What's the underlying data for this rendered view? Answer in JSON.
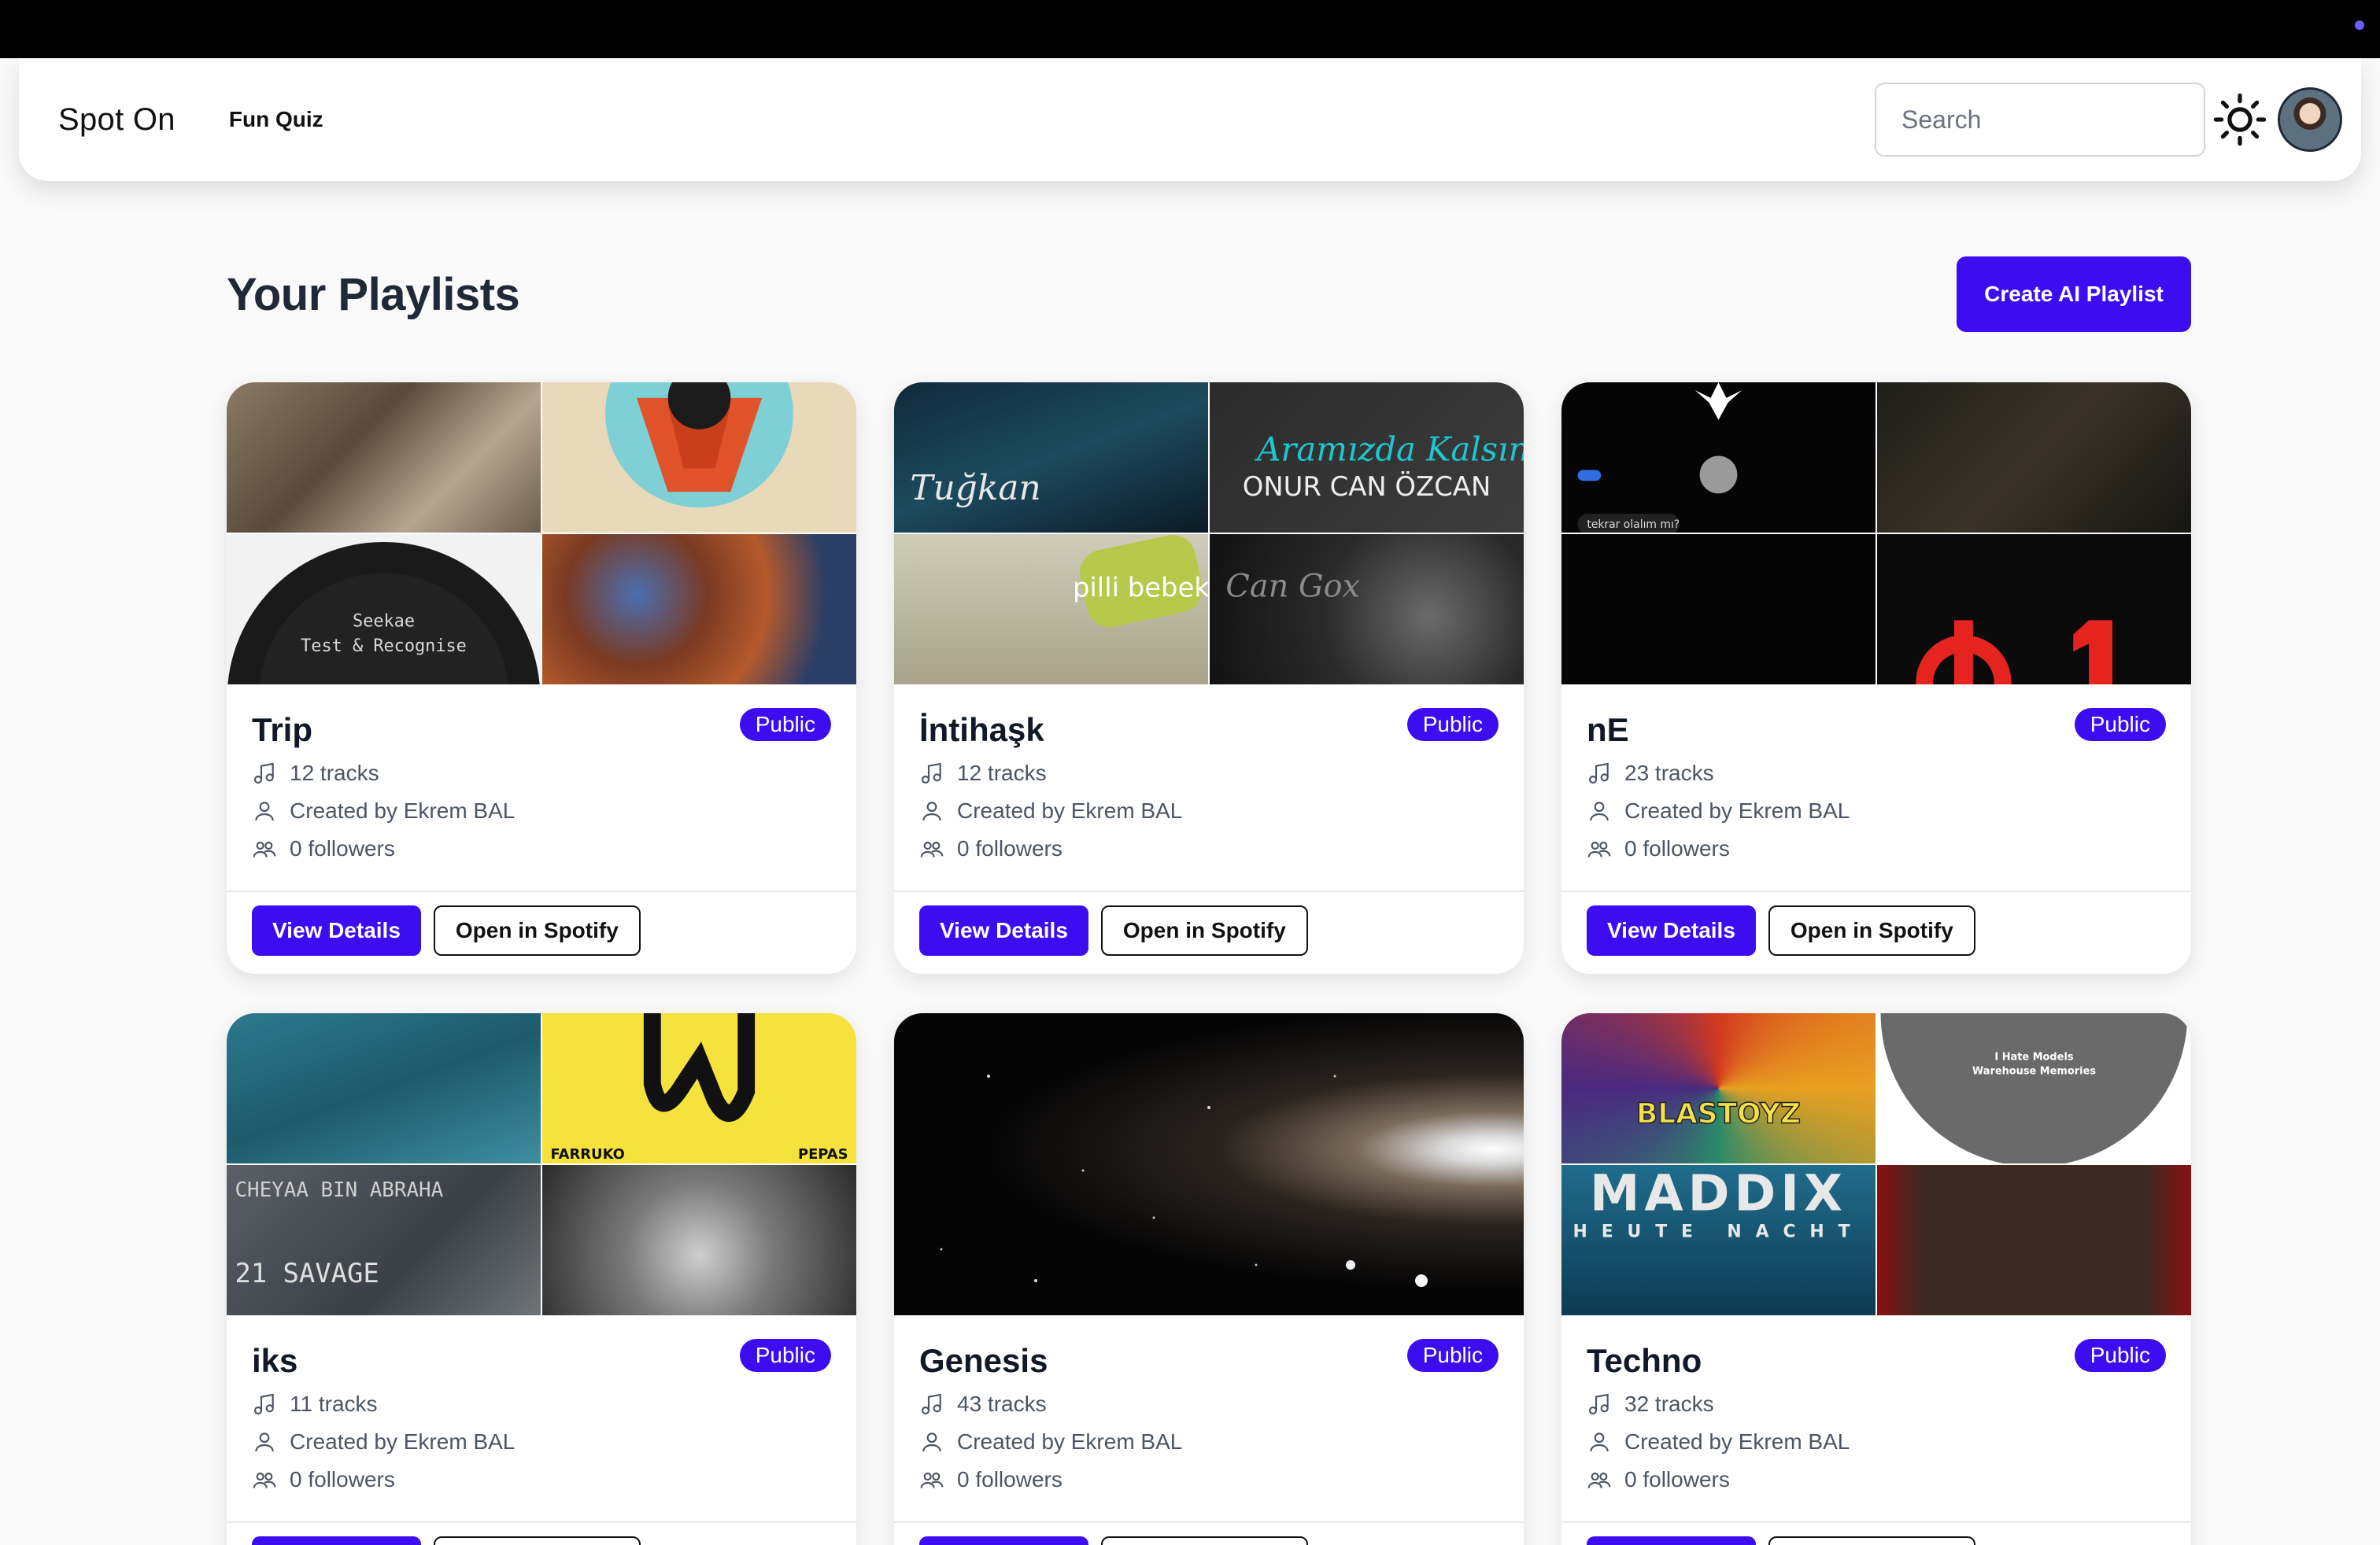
{
  "nav": {
    "brand": "Spot On",
    "link_fun_quiz": "Fun Quiz",
    "search_placeholder": "Search"
  },
  "header": {
    "title": "Your Playlists",
    "create_button": "Create AI Playlist"
  },
  "colors": {
    "accent": "#3c0df0",
    "topbar": "#000000"
  },
  "labels": {
    "view_details": "View Details",
    "open_spotify": "Open in Spotify",
    "public": "Public"
  },
  "playlists": [
    {
      "name": "Trip",
      "tracks": "12 tracks",
      "creator": "Created by Ekrem BAL",
      "followers": "0 followers",
      "cover_text": "Seekae\nTest & Recognise"
    },
    {
      "name": "İntihaşk",
      "tracks": "12 tracks",
      "creator": "Created by Ekrem BAL",
      "followers": "0 followers",
      "cover_text": "ONUR CAN ÖZCAN"
    },
    {
      "name": "nE",
      "tracks": "23 tracks",
      "creator": "Created by Ekrem BAL",
      "followers": "0 followers",
      "cover_text": "tekrar olalım mı?"
    },
    {
      "name": "iks",
      "tracks": "11 tracks",
      "creator": "Created by Ekrem BAL",
      "followers": "0 followers",
      "cover_text": "21 SAVAGE"
    },
    {
      "name": "Genesis",
      "tracks": "43 tracks",
      "creator": "Created by Ekrem BAL",
      "followers": "0 followers",
      "cover_text": ""
    },
    {
      "name": "Techno",
      "tracks": "32 tracks",
      "creator": "Created by Ekrem BAL",
      "followers": "0 followers",
      "cover_text": "MADDIX\nHEUTE NACHT"
    }
  ]
}
